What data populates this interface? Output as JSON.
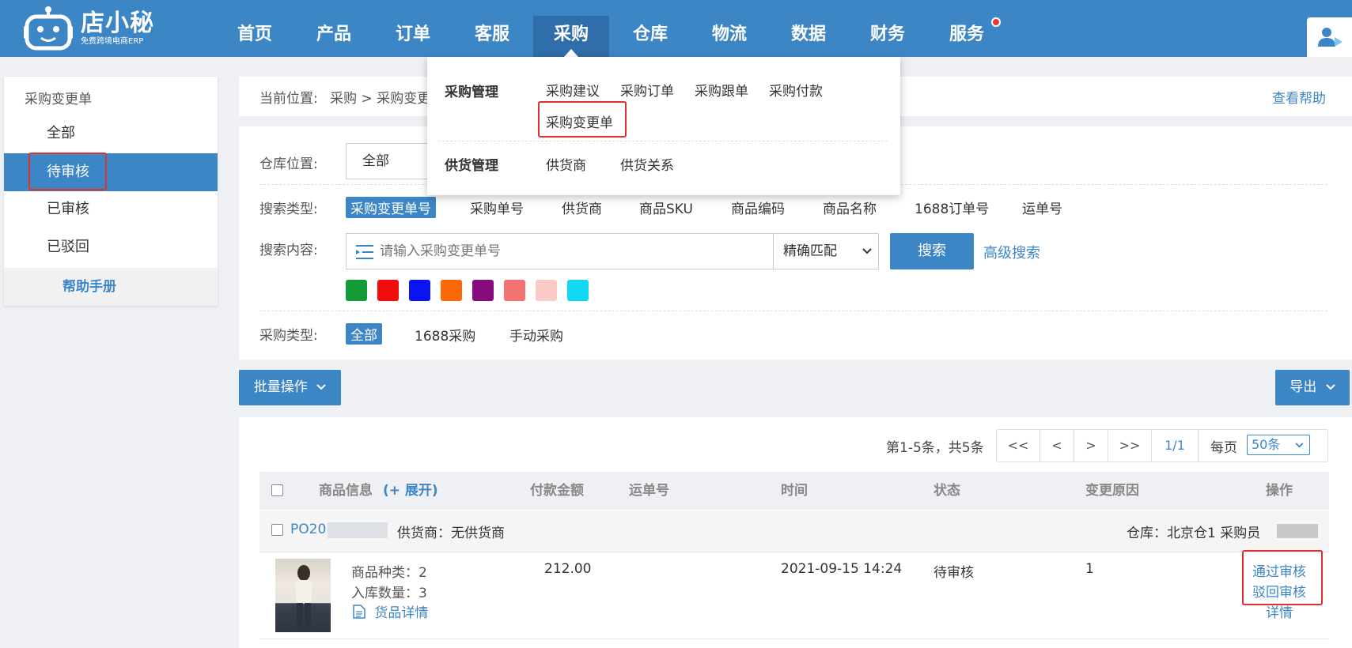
{
  "header": {
    "logo_name": "店小秘",
    "logo_sub": "免费跨境电商ERP",
    "nav": [
      "首页",
      "产品",
      "订单",
      "客服",
      "采购",
      "仓库",
      "物流",
      "数据",
      "财务",
      "服务"
    ],
    "active_nav": "采购"
  },
  "sidebar": {
    "title": "采购变更单",
    "items": [
      "全部",
      "待审核",
      "已审核",
      "已驳回"
    ],
    "active_item": "待审核",
    "help": "帮助手册"
  },
  "breadcrumb": {
    "prefix": "当前位置:",
    "path1": "采购",
    "sep": ">",
    "path2": "采购变更单",
    "help": "查看帮助"
  },
  "dropdown": {
    "group1_title": "采购管理",
    "group1_items": [
      "采购建议",
      "采购订单",
      "采购跟单",
      "采购付款",
      "采购变更单"
    ],
    "group2_title": "供货管理",
    "group2_items": [
      "供货商",
      "供货关系"
    ]
  },
  "filters": {
    "warehouse_label": "仓库位置:",
    "warehouse_value": "全部",
    "search_type_label": "搜索类型:",
    "search_types": [
      "采购变更单号",
      "采购单号",
      "供货商",
      "商品SKU",
      "商品编码",
      "商品名称",
      "1688订单号",
      "运单号"
    ],
    "search_content_label": "搜索内容:",
    "search_placeholder": "请输入采购变更单号",
    "match_mode": "精确匹配",
    "search_btn": "搜索",
    "advanced": "高级搜索",
    "colors": [
      "#149a37",
      "#f20d0d",
      "#0a14f0",
      "#fb6a06",
      "#880b7e",
      "#f37272",
      "#fbc9c6",
      "#13d8f3"
    ],
    "purchase_type_label": "采购类型:",
    "purchase_types": [
      "全部",
      "1688采购",
      "手动采购"
    ]
  },
  "actions": {
    "batch": "批量操作",
    "export": "导出"
  },
  "pager": {
    "summary": "第1-5条，共5条",
    "first": "<<",
    "prev": "<",
    "next": ">",
    "last": ">>",
    "page": "1/1",
    "per_page_label": "每页",
    "per_page": "50条"
  },
  "table": {
    "headers": {
      "product": "商品信息",
      "expand": "(+ 展开)",
      "amount": "付款金额",
      "tracking": "运单号",
      "time": "时间",
      "status": "状态",
      "reason": "变更原因",
      "ops": "操作"
    },
    "group": {
      "po": "PO20",
      "supplier": "供货商：无供货商",
      "warehouse": "仓库：北京仓1 采购员"
    },
    "row": {
      "kinds": "商品种类：2",
      "qty": "入库数量：3",
      "detail_link": "货品详情",
      "amount": "212.00",
      "time": "2021-09-15 14:24",
      "status": "待审核",
      "reason": "1",
      "op_approve": "通过审核",
      "op_reject": "驳回审核",
      "op_detail": "详情"
    }
  }
}
